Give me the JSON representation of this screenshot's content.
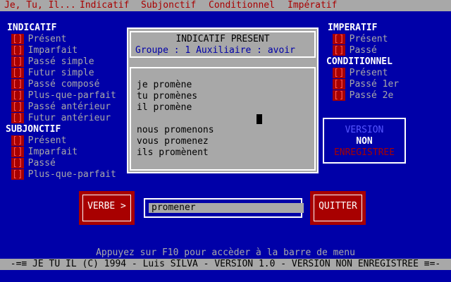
{
  "menu": {
    "items": [
      "Je, Tu, Il...",
      "Indicatif",
      "Subjonctif",
      "Conditionnel",
      "Impératif"
    ]
  },
  "left": {
    "indicatif_title": "INDICATIF",
    "indicatif_items": [
      "Présent",
      "Imparfait",
      "Passé simple",
      "Futur simple",
      "Passé composé",
      "Plus-que-parfait",
      "Passé antérieur",
      "Futur antérieur"
    ],
    "subjonctif_title": "SUBJONCTIF",
    "subjonctif_items": [
      "Présent",
      "Imparfait",
      "Passé",
      "Plus-que-parfait"
    ],
    "box_glyph": "[]"
  },
  "right": {
    "imperatif_title": "IMPERATIF",
    "imperatif_items": [
      "Présent",
      "Passé"
    ],
    "conditionnel_title": "CONDITIONNEL",
    "conditionnel_items": [
      "Présent",
      "Passé 1er",
      "Passé 2e"
    ]
  },
  "panel": {
    "title": "INDICATIF PRESENT",
    "group_line": "Groupe : 1   Auxiliaire : avoir",
    "conjugations": [
      "je promène",
      "tu promènes",
      "il promène",
      "",
      "nous promenons",
      "vous promenez",
      "ils promènent"
    ]
  },
  "version": {
    "line1": "VERSION",
    "line2": "NON",
    "line3": "ENREGISTREE",
    "colors": {
      "line1": "#5555ff",
      "line2": "#ffffff",
      "line3": "#a80000"
    }
  },
  "buttons": {
    "verbe": "VERBE >",
    "quitter": "QUITTER"
  },
  "input": {
    "value": "promener"
  },
  "hint": "Appuyez sur F10 pour accèder à la barre de menu",
  "status": "-=≡ JE TU IL (C) 1994 - Luis SILVA - VERSION 1.0 - VERSION NON ENREGISTREE ≡=-"
}
